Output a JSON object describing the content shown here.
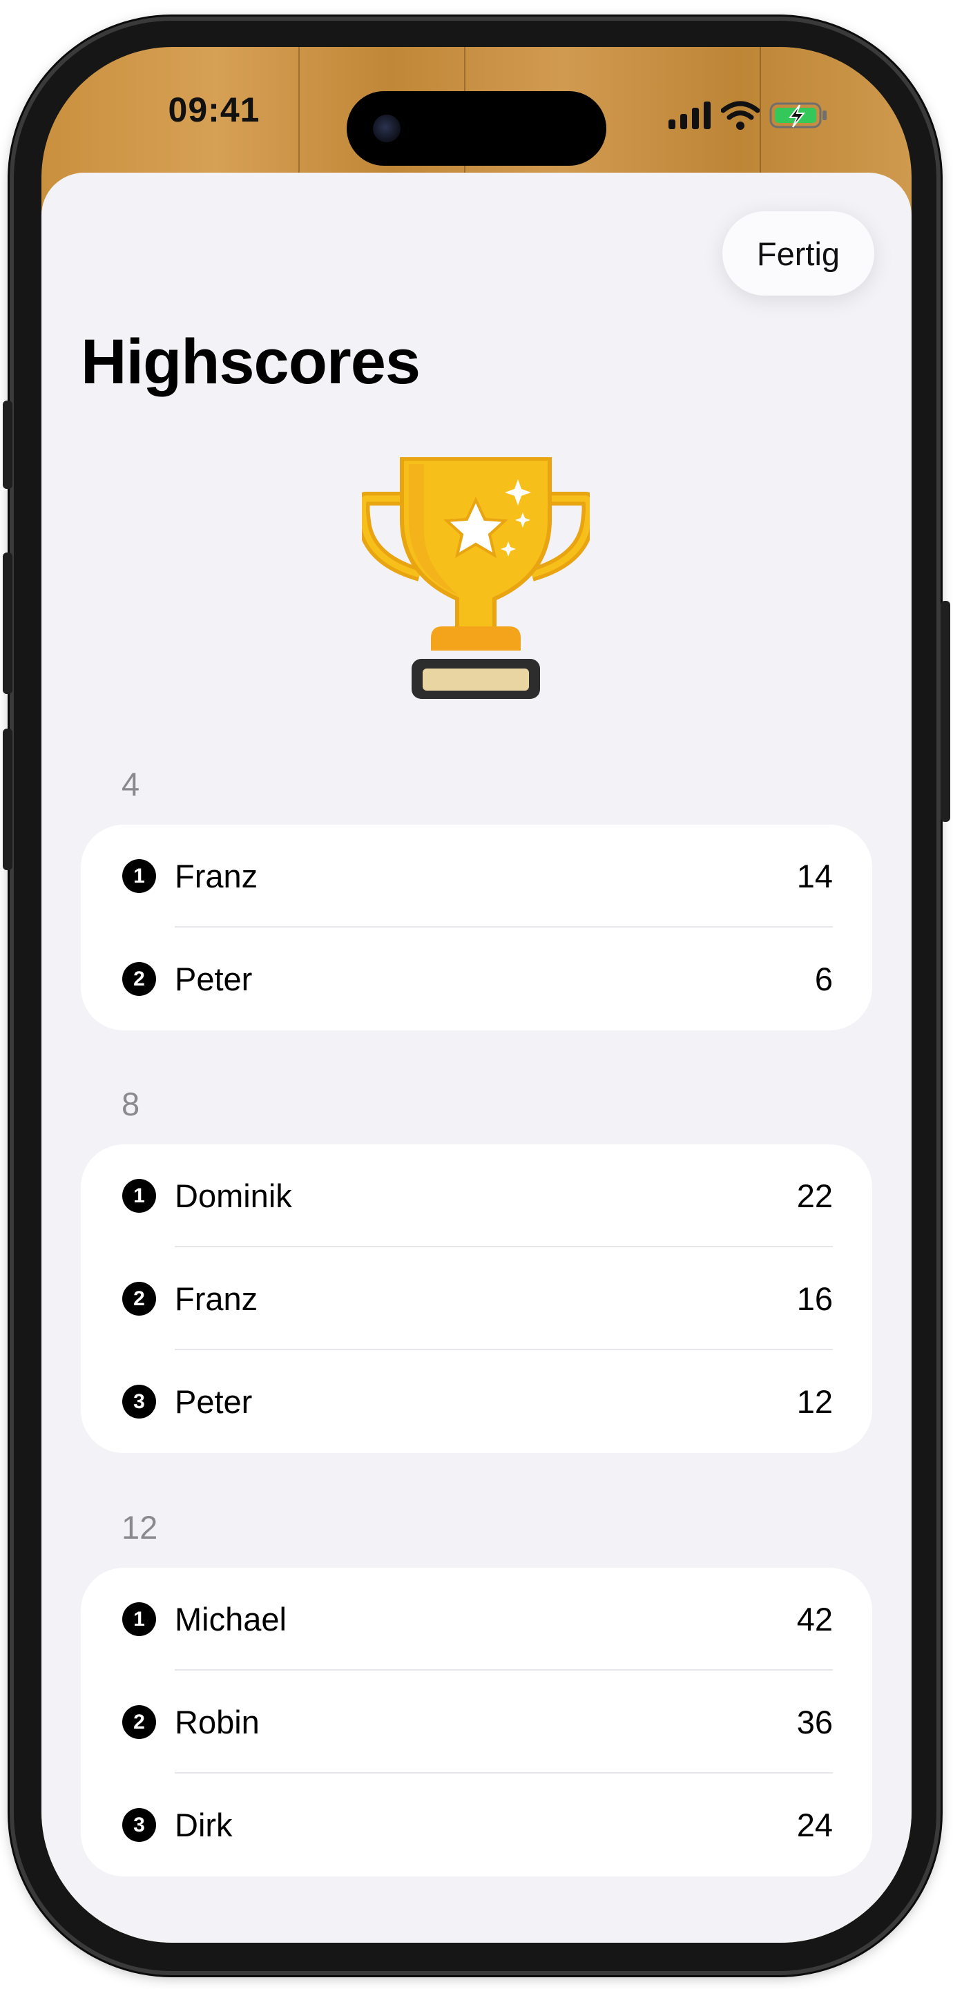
{
  "status_bar": {
    "time": "09:41"
  },
  "nav": {
    "done_label": "Fertig"
  },
  "page": {
    "title": "Highscores"
  },
  "icons": {
    "trophy": "trophy-icon",
    "battery": "battery-charging-icon",
    "wifi": "wifi-icon",
    "signal": "cellular-signal-icon"
  },
  "colors": {
    "background": "#f2f2f7",
    "card": "#ffffff",
    "header_text": "#8a8a8e",
    "trophy_gold": "#f7bf1a"
  },
  "sections": [
    {
      "header": "4",
      "rows": [
        {
          "rank": "1",
          "name": "Franz",
          "score": "14"
        },
        {
          "rank": "2",
          "name": "Peter",
          "score": "6"
        }
      ]
    },
    {
      "header": "8",
      "rows": [
        {
          "rank": "1",
          "name": "Dominik",
          "score": "22"
        },
        {
          "rank": "2",
          "name": "Franz",
          "score": "16"
        },
        {
          "rank": "3",
          "name": "Peter",
          "score": "12"
        }
      ]
    },
    {
      "header": "12",
      "rows": [
        {
          "rank": "1",
          "name": "Michael",
          "score": "42"
        },
        {
          "rank": "2",
          "name": "Robin",
          "score": "36"
        },
        {
          "rank": "3",
          "name": "Dirk",
          "score": "24"
        }
      ]
    }
  ]
}
